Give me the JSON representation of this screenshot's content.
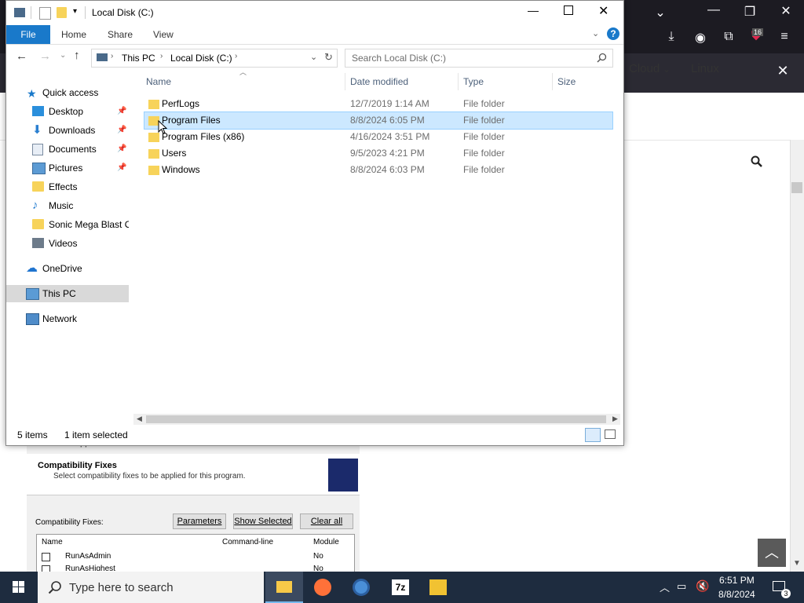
{
  "explorer": {
    "title": "Local Disk (C:)",
    "ribbon_tabs": [
      "File",
      "Home",
      "Share",
      "View"
    ],
    "breadcrumb": [
      "This PC",
      "Local Disk (C:)"
    ],
    "search_placeholder": "Search Local Disk (C:)",
    "columns": [
      "Name",
      "Date modified",
      "Type",
      "Size"
    ],
    "nav": [
      {
        "label": "Quick access",
        "icon": "star-icon"
      },
      {
        "label": "Desktop",
        "icon": "desktop-icon",
        "pinned": true
      },
      {
        "label": "Downloads",
        "icon": "download-icon",
        "pinned": true
      },
      {
        "label": "Documents",
        "icon": "documents-icon",
        "pinned": true
      },
      {
        "label": "Pictures",
        "icon": "pictures-icon",
        "pinned": true
      },
      {
        "label": "Effects",
        "icon": "folder-icon"
      },
      {
        "label": "Music",
        "icon": "music-icon"
      },
      {
        "label": "Sonic Mega Blast O",
        "icon": "folder-icon"
      },
      {
        "label": "Videos",
        "icon": "videos-icon"
      },
      {
        "label": "OneDrive",
        "icon": "cloud-icon"
      },
      {
        "label": "This PC",
        "icon": "computer-icon",
        "selected": true
      },
      {
        "label": "Network",
        "icon": "network-icon"
      }
    ],
    "rows": [
      {
        "name": "PerfLogs",
        "date": "12/7/2019 1:14 AM",
        "type": "File folder"
      },
      {
        "name": "Program Files",
        "date": "8/8/2024 6:05 PM",
        "type": "File folder",
        "selected": true
      },
      {
        "name": "Program Files (x86)",
        "date": "4/16/2024 3:51 PM",
        "type": "File folder"
      },
      {
        "name": "Users",
        "date": "9/5/2023 4:21 PM",
        "type": "File folder"
      },
      {
        "name": "Windows",
        "date": "8/8/2024 6:03 PM",
        "type": "File folder"
      }
    ],
    "status_items": "5 items",
    "status_selected": "1 item selected"
  },
  "browser": {
    "badge": "16",
    "nav_cloud": "Cloud",
    "nav_linux": "Linux"
  },
  "compat": {
    "title": "Compatibility Fixes",
    "subtitle": "Select compatibility fixes to be applied for this program.",
    "partial": "Create new Application Fix",
    "fixes_label": "Compatibility Fixes:",
    "buttons": [
      "Parameters",
      "Show Selected",
      "Clear all"
    ],
    "columns": [
      "Name",
      "Command-line",
      "Module"
    ],
    "rows": [
      {
        "name": "RunAsAdmin",
        "module": "No"
      },
      {
        "name": "RunAsHighest",
        "module": "No"
      }
    ]
  },
  "taskbar": {
    "search_placeholder": "Type here to search",
    "time": "6:51 PM",
    "date": "8/8/2024",
    "notifications": "3"
  },
  "colors": {
    "accent": "#1979ca",
    "selection": "#cce8ff",
    "taskbar": "#1e2c3f"
  }
}
